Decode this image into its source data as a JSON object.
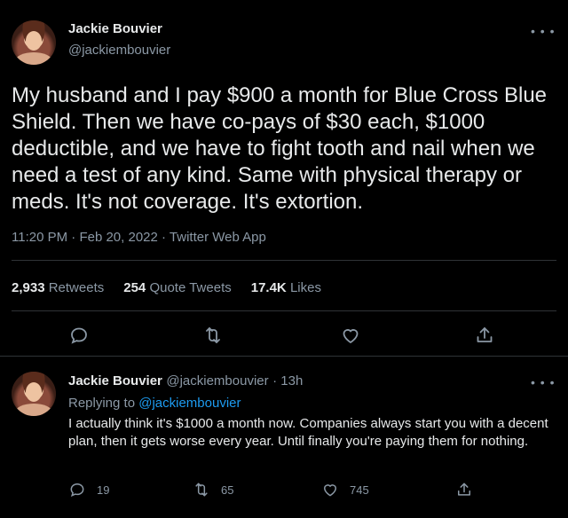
{
  "main_tweet": {
    "author_name": "Jackie Bouvier",
    "author_handle": "@jackiembouvier",
    "text": "My husband and I pay $900 a month for Blue Cross Blue Shield. Then we have co-pays of $30 each, $1000 deductible, and we have to fight tooth and nail when we need a test of any kind. Same with physical therapy or meds. It's not coverage. It's extortion.",
    "time": "11:20 PM",
    "date": "Feb 20, 2022",
    "source": "Twitter Web App",
    "retweets_count": "2,933",
    "retweets_label": "Retweets",
    "quotes_count": "254",
    "quotes_label": "Quote Tweets",
    "likes_count": "17.4K",
    "likes_label": "Likes"
  },
  "reply": {
    "author_name": "Jackie Bouvier",
    "author_handle": "@jackiembouvier",
    "age": "13h",
    "replying_prefix": "Replying to",
    "replying_handle": "@jackiembouvier",
    "text": "I actually think it's $1000 a month now. Companies always start you with a decent plan, then it gets worse every year. Until finally you're paying them for nothing.",
    "reply_count": "19",
    "retweet_count": "65",
    "like_count": "745"
  },
  "icons": {
    "more": "more-horizontal-icon",
    "reply": "reply-bubble-icon",
    "retweet": "retweet-icon",
    "like": "heart-icon",
    "share": "share-upload-icon"
  },
  "colors": {
    "background": "#000000",
    "text": "#e7e9ea",
    "muted": "#8b98a5",
    "link": "#1d9bf0",
    "divider": "#2f3336"
  }
}
